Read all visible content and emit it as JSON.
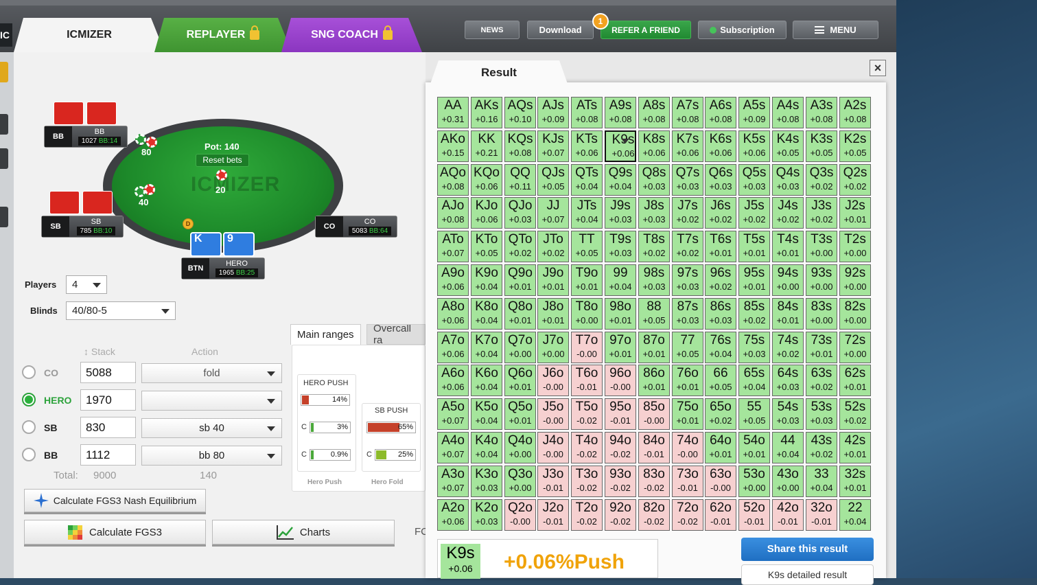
{
  "topbar": {
    "left_edge": "IC",
    "tabs": [
      {
        "label": "ICMIZER"
      },
      {
        "label": "REPLAYER"
      },
      {
        "label": "SNG COACH"
      }
    ],
    "buttons": {
      "news": "NEWS",
      "download": "Download",
      "refer": "REFER A FRIEND",
      "refer_badge": "1",
      "subscription": "Subscription",
      "menu": "MENU"
    }
  },
  "table": {
    "watermark": "ICMIZER",
    "pot": "Pot: 140",
    "reset_bets": "Reset bets",
    "bb_bet": "80",
    "sb_bet": "40",
    "ante": "20",
    "dealer": "D",
    "seats": {
      "bb": {
        "pos": "BB",
        "name": "BB",
        "stack": "1027",
        "bb": "BB:14"
      },
      "sb": {
        "pos": "SB",
        "name": "SB",
        "stack": "785",
        "bb": "BB:10"
      },
      "co": {
        "pos": "CO",
        "name": "CO",
        "stack": "5083",
        "bb": "BB:64"
      },
      "btn": {
        "pos": "BTN",
        "name": "HERO",
        "stack": "1965",
        "bb": "BB:25"
      }
    },
    "hero_cards": [
      "K",
      "9"
    ]
  },
  "settings": {
    "players_label": "Players",
    "players_value": "4",
    "blinds_label": "Blinds",
    "blinds_value": "40/80-5"
  },
  "players_table": {
    "stack_header": "Stack",
    "action_header": "Action",
    "rows": [
      {
        "pos": "CO",
        "stack": "5088",
        "action": "fold"
      },
      {
        "pos": "HERO",
        "stack": "1970",
        "action": ""
      },
      {
        "pos": "SB",
        "stack": "830",
        "action": "sb 40"
      },
      {
        "pos": "BB",
        "stack": "1112",
        "action": "bb 80"
      }
    ],
    "total_label": "Total:",
    "total_stack": "9000",
    "total_bets": "140"
  },
  "buttons": {
    "nash": "Calculate FGS3 Nash Equilibrium",
    "calc": "Calculate FGS3",
    "charts": "Charts",
    "fc": "FC"
  },
  "ranges": {
    "tab_main": "Main ranges",
    "tab_overcall": "Overcall ra",
    "hero_push": "HERO PUSH",
    "hero_push_pct": "14%",
    "hero_push_fill": 0.14,
    "c1": "C",
    "c1_pct": "3%",
    "c1_fill": 0.03,
    "c2": "C",
    "c2_pct": "0.9%",
    "c2_fill": 0.009,
    "sb_push": "SB PUSH",
    "sb_push_pct": "65%",
    "sb_push_fill": 0.65,
    "c3": "C",
    "c3_pct": "25%",
    "c3_fill": 0.25,
    "label_hero": "Hero Push",
    "label_fold": "Hero Fold"
  },
  "result": {
    "title": "Result",
    "close": "×",
    "grid": [
      [
        [
          "AA",
          "+0.31"
        ],
        [
          "AKs",
          "+0.16"
        ],
        [
          "AQs",
          "+0.10"
        ],
        [
          "AJs",
          "+0.09"
        ],
        [
          "ATs",
          "+0.08"
        ],
        [
          "A9s",
          "+0.08"
        ],
        [
          "A8s",
          "+0.08"
        ],
        [
          "A7s",
          "+0.08"
        ],
        [
          "A6s",
          "+0.08"
        ],
        [
          "A5s",
          "+0.09"
        ],
        [
          "A4s",
          "+0.08"
        ],
        [
          "A3s",
          "+0.08"
        ],
        [
          "A2s",
          "+0.08"
        ]
      ],
      [
        [
          "AKo",
          "+0.15"
        ],
        [
          "KK",
          "+0.21"
        ],
        [
          "KQs",
          "+0.08"
        ],
        [
          "KJs",
          "+0.07"
        ],
        [
          "KTs",
          "+0.06"
        ],
        [
          "K9s",
          "+0.06"
        ],
        [
          "K8s",
          "+0.06"
        ],
        [
          "K7s",
          "+0.06"
        ],
        [
          "K6s",
          "+0.06"
        ],
        [
          "K5s",
          "+0.06"
        ],
        [
          "K4s",
          "+0.05"
        ],
        [
          "K3s",
          "+0.05"
        ],
        [
          "K2s",
          "+0.05"
        ]
      ],
      [
        [
          "AQo",
          "+0.08"
        ],
        [
          "KQo",
          "+0.06"
        ],
        [
          "QQ",
          "+0.11"
        ],
        [
          "QJs",
          "+0.05"
        ],
        [
          "QTs",
          "+0.04"
        ],
        [
          "Q9s",
          "+0.04"
        ],
        [
          "Q8s",
          "+0.03"
        ],
        [
          "Q7s",
          "+0.03"
        ],
        [
          "Q6s",
          "+0.03"
        ],
        [
          "Q5s",
          "+0.03"
        ],
        [
          "Q4s",
          "+0.03"
        ],
        [
          "Q3s",
          "+0.02"
        ],
        [
          "Q2s",
          "+0.02"
        ]
      ],
      [
        [
          "AJo",
          "+0.08"
        ],
        [
          "KJo",
          "+0.06"
        ],
        [
          "QJo",
          "+0.03"
        ],
        [
          "JJ",
          "+0.07"
        ],
        [
          "JTs",
          "+0.04"
        ],
        [
          "J9s",
          "+0.03"
        ],
        [
          "J8s",
          "+0.03"
        ],
        [
          "J7s",
          "+0.02"
        ],
        [
          "J6s",
          "+0.02"
        ],
        [
          "J5s",
          "+0.02"
        ],
        [
          "J4s",
          "+0.02"
        ],
        [
          "J3s",
          "+0.02"
        ],
        [
          "J2s",
          "+0.01"
        ]
      ],
      [
        [
          "ATo",
          "+0.07"
        ],
        [
          "KTo",
          "+0.05"
        ],
        [
          "QTo",
          "+0.02"
        ],
        [
          "JTo",
          "+0.02"
        ],
        [
          "TT",
          "+0.05"
        ],
        [
          "T9s",
          "+0.03"
        ],
        [
          "T8s",
          "+0.02"
        ],
        [
          "T7s",
          "+0.02"
        ],
        [
          "T6s",
          "+0.01"
        ],
        [
          "T5s",
          "+0.01"
        ],
        [
          "T4s",
          "+0.01"
        ],
        [
          "T3s",
          "+0.00"
        ],
        [
          "T2s",
          "+0.00"
        ]
      ],
      [
        [
          "A9o",
          "+0.06"
        ],
        [
          "K9o",
          "+0.04"
        ],
        [
          "Q9o",
          "+0.01"
        ],
        [
          "J9o",
          "+0.01"
        ],
        [
          "T9o",
          "+0.01"
        ],
        [
          "99",
          "+0.04"
        ],
        [
          "98s",
          "+0.03"
        ],
        [
          "97s",
          "+0.03"
        ],
        [
          "96s",
          "+0.02"
        ],
        [
          "95s",
          "+0.01"
        ],
        [
          "94s",
          "+0.00"
        ],
        [
          "93s",
          "+0.00"
        ],
        [
          "92s",
          "+0.00"
        ]
      ],
      [
        [
          "A8o",
          "+0.06"
        ],
        [
          "K8o",
          "+0.04"
        ],
        [
          "Q8o",
          "+0.01"
        ],
        [
          "J8o",
          "+0.01"
        ],
        [
          "T8o",
          "+0.00"
        ],
        [
          "98o",
          "+0.01"
        ],
        [
          "88",
          "+0.05"
        ],
        [
          "87s",
          "+0.03"
        ],
        [
          "86s",
          "+0.03"
        ],
        [
          "85s",
          "+0.02"
        ],
        [
          "84s",
          "+0.01"
        ],
        [
          "83s",
          "+0.00"
        ],
        [
          "82s",
          "+0.00"
        ]
      ],
      [
        [
          "A7o",
          "+0.06"
        ],
        [
          "K7o",
          "+0.04"
        ],
        [
          "Q7o",
          "+0.00"
        ],
        [
          "J7o",
          "+0.00"
        ],
        [
          "T7o",
          "-0.00"
        ],
        [
          "97o",
          "+0.01"
        ],
        [
          "87o",
          "+0.01"
        ],
        [
          "77",
          "+0.05"
        ],
        [
          "76s",
          "+0.04"
        ],
        [
          "75s",
          "+0.03"
        ],
        [
          "74s",
          "+0.02"
        ],
        [
          "73s",
          "+0.01"
        ],
        [
          "72s",
          "+0.00"
        ]
      ],
      [
        [
          "A6o",
          "+0.06"
        ],
        [
          "K6o",
          "+0.04"
        ],
        [
          "Q6o",
          "+0.01"
        ],
        [
          "J6o",
          "-0.00"
        ],
        [
          "T6o",
          "-0.01"
        ],
        [
          "96o",
          "-0.00"
        ],
        [
          "86o",
          "+0.01"
        ],
        [
          "76o",
          "+0.01"
        ],
        [
          "66",
          "+0.05"
        ],
        [
          "65s",
          "+0.04"
        ],
        [
          "64s",
          "+0.03"
        ],
        [
          "63s",
          "+0.02"
        ],
        [
          "62s",
          "+0.01"
        ]
      ],
      [
        [
          "A5o",
          "+0.07"
        ],
        [
          "K5o",
          "+0.04"
        ],
        [
          "Q5o",
          "+0.01"
        ],
        [
          "J5o",
          "-0.00"
        ],
        [
          "T5o",
          "-0.02"
        ],
        [
          "95o",
          "-0.01"
        ],
        [
          "85o",
          "-0.00"
        ],
        [
          "75o",
          "+0.01"
        ],
        [
          "65o",
          "+0.02"
        ],
        [
          "55",
          "+0.05"
        ],
        [
          "54s",
          "+0.03"
        ],
        [
          "53s",
          "+0.03"
        ],
        [
          "52s",
          "+0.02"
        ]
      ],
      [
        [
          "A4o",
          "+0.07"
        ],
        [
          "K4o",
          "+0.04"
        ],
        [
          "Q4o",
          "+0.00"
        ],
        [
          "J4o",
          "-0.00"
        ],
        [
          "T4o",
          "-0.02"
        ],
        [
          "94o",
          "-0.02"
        ],
        [
          "84o",
          "-0.01"
        ],
        [
          "74o",
          "-0.00"
        ],
        [
          "64o",
          "+0.01"
        ],
        [
          "54o",
          "+0.01"
        ],
        [
          "44",
          "+0.04"
        ],
        [
          "43s",
          "+0.02"
        ],
        [
          "42s",
          "+0.01"
        ]
      ],
      [
        [
          "A3o",
          "+0.07"
        ],
        [
          "K3o",
          "+0.03"
        ],
        [
          "Q3o",
          "+0.00"
        ],
        [
          "J3o",
          "-0.01"
        ],
        [
          "T3o",
          "-0.02"
        ],
        [
          "93o",
          "-0.02"
        ],
        [
          "83o",
          "-0.02"
        ],
        [
          "73o",
          "-0.01"
        ],
        [
          "63o",
          "-0.00"
        ],
        [
          "53o",
          "+0.00"
        ],
        [
          "43o",
          "+0.00"
        ],
        [
          "33",
          "+0.04"
        ],
        [
          "32s",
          "+0.01"
        ]
      ],
      [
        [
          "A2o",
          "+0.06"
        ],
        [
          "K2o",
          "+0.03"
        ],
        [
          "Q2o",
          "-0.00"
        ],
        [
          "J2o",
          "-0.01"
        ],
        [
          "T2o",
          "-0.02"
        ],
        [
          "92o",
          "-0.02"
        ],
        [
          "82o",
          "-0.02"
        ],
        [
          "72o",
          "-0.02"
        ],
        [
          "62o",
          "-0.01"
        ],
        [
          "52o",
          "-0.01"
        ],
        [
          "42o",
          "-0.01"
        ],
        [
          "32o",
          "-0.01"
        ],
        [
          "22",
          "+0.04"
        ]
      ]
    ],
    "push_flags": [
      [
        1,
        1,
        1,
        1,
        1,
        1,
        1,
        1,
        1,
        1,
        1,
        1,
        1
      ],
      [
        1,
        1,
        1,
        1,
        1,
        1,
        1,
        1,
        1,
        1,
        1,
        1,
        1
      ],
      [
        1,
        1,
        1,
        1,
        1,
        1,
        1,
        1,
        1,
        1,
        1,
        1,
        1
      ],
      [
        1,
        1,
        1,
        1,
        1,
        1,
        1,
        1,
        1,
        1,
        1,
        1,
        1
      ],
      [
        1,
        1,
        1,
        1,
        1,
        1,
        1,
        1,
        1,
        1,
        1,
        1,
        1
      ],
      [
        1,
        1,
        1,
        1,
        1,
        1,
        1,
        1,
        1,
        1,
        1,
        1,
        1
      ],
      [
        1,
        1,
        1,
        1,
        1,
        1,
        1,
        1,
        1,
        1,
        1,
        1,
        1
      ],
      [
        1,
        1,
        1,
        1,
        0,
        1,
        1,
        1,
        1,
        1,
        1,
        1,
        1
      ],
      [
        1,
        1,
        1,
        0,
        0,
        0,
        1,
        1,
        1,
        1,
        1,
        1,
        1
      ],
      [
        1,
        1,
        1,
        0,
        0,
        0,
        0,
        1,
        1,
        1,
        1,
        1,
        1
      ],
      [
        1,
        1,
        1,
        0,
        0,
        0,
        0,
        0,
        1,
        1,
        1,
        1,
        1
      ],
      [
        1,
        1,
        1,
        0,
        0,
        0,
        0,
        0,
        0,
        1,
        1,
        1,
        1
      ],
      [
        1,
        1,
        0,
        0,
        0,
        0,
        0,
        0,
        0,
        0,
        0,
        0,
        1
      ]
    ],
    "selected": "K9s",
    "detail_hand": "K9s",
    "detail_value": "+0.06",
    "detail_push": "+0.06%Push",
    "share": "Share this result",
    "detail_button": "K9s detailed result"
  }
}
